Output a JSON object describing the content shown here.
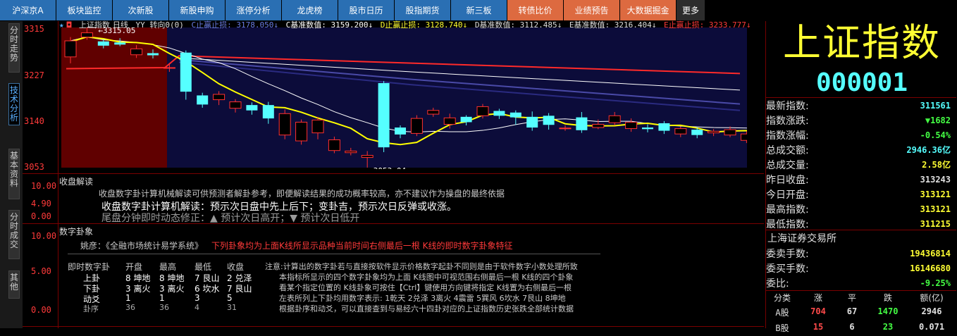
{
  "nav": [
    "沪深京A",
    "板块监控",
    "次新股",
    "新股申购",
    "涨停分析",
    "龙虎榜",
    "股市日历",
    "股指期货",
    "新三板",
    "转债比价",
    "业绩预告",
    "大数据掘金",
    "更多"
  ],
  "sidetabs": [
    "分时走势",
    "技术分析",
    "基本资料",
    "分时成交",
    "其他"
  ],
  "kchart": {
    "y_labels": [
      "3315",
      "3227",
      "3140",
      "3053"
    ],
    "legend": {
      "name": "上证指数",
      "period": "日线",
      "indicator": "YY 转向0(0)",
      "c_stop": "C止赢止损: 3178.050↓",
      "c_base": "C基准数值: 3159.200↓",
      "d_stop": "D止赢止损: 3128.740↓",
      "d_base": "D基准数值: 3112.485↓",
      "e_base": "E基准数值: 3216.404↓",
      "e_stop": "E止赢止损: 3233.777↓"
    },
    "high_label": "3315.05",
    "low_label": "3053.04"
  },
  "chart_data": {
    "type": "candlestick",
    "ylim": [
      3053,
      3315
    ],
    "high_annotation": 3315.05,
    "low_annotation": 3053.04,
    "candles": [
      [
        3260,
        3290,
        3297,
        3248
      ],
      [
        3297,
        3305,
        3315.05,
        3292
      ],
      [
        3289,
        3281,
        3293,
        3276
      ],
      [
        3287,
        3283,
        3295,
        3280
      ],
      [
        3264,
        3275,
        3282,
        3258
      ],
      [
        3267,
        3263,
        3274,
        3257
      ],
      [
        3240,
        3240,
        3247,
        3232
      ],
      [
        3268,
        3195,
        3272,
        3180
      ],
      [
        3188,
        3171,
        3193,
        3165
      ],
      [
        3180,
        3190,
        3196,
        3170
      ],
      [
        3164,
        3176,
        3181,
        3156
      ],
      [
        3170,
        3160,
        3175,
        3152
      ],
      [
        3170,
        3145,
        3176,
        3135
      ],
      [
        3114,
        3154,
        3162,
        3106
      ],
      [
        3103,
        3138,
        3143,
        3096
      ],
      [
        3118,
        3142,
        3148,
        3106
      ],
      [
        3085,
        3105,
        3111,
        3080
      ],
      [
        3081,
        3084,
        3090,
        3076
      ],
      [
        3072,
        3076,
        3084,
        3053.04
      ],
      [
        3211,
        3091,
        3215,
        3082
      ],
      [
        3128,
        3115,
        3132,
        3108
      ],
      [
        3117,
        3145,
        3151,
        3112
      ],
      [
        3153,
        3160,
        3165,
        3148
      ],
      [
        3134,
        3146,
        3154,
        3126
      ],
      [
        3148,
        3138,
        3151,
        3132
      ],
      [
        3150,
        3167,
        3172,
        3145
      ],
      [
        3159,
        3150,
        3163,
        3144
      ],
      [
        3156,
        3147,
        3160,
        3133
      ],
      [
        3148,
        3128,
        3158,
        3122
      ],
      [
        3150,
        3133,
        3155,
        3124
      ],
      [
        3127,
        3127,
        3132,
        3122
      ],
      [
        3147,
        3123,
        3157,
        3118
      ],
      [
        3128,
        3134,
        3143,
        3125
      ],
      [
        3137,
        3150,
        3157,
        3132
      ],
      [
        3126,
        3138,
        3145,
        3120
      ],
      [
        3128,
        3125,
        3134,
        3119
      ],
      [
        3136,
        3122,
        3140,
        3116
      ],
      [
        3116,
        3126,
        3130,
        3110
      ],
      [
        3124,
        3114,
        3128,
        3108
      ],
      [
        3118,
        3121,
        3125,
        3112
      ],
      [
        3114,
        3124,
        3130,
        3110
      ],
      [
        3104,
        3116,
        3121,
        3099
      ],
      [
        3110,
        3094,
        3114,
        3087
      ],
      [
        3090,
        3131,
        3134,
        3086
      ],
      [
        3133,
        3116,
        3136,
        3112
      ]
    ]
  },
  "shoupan": {
    "title": "收盘解读",
    "y_labels": [
      "10.00",
      "4.90",
      "0.00"
    ],
    "line1": "收盘数字卦计算机械解读可供预测者解卦参考，即便解读结果的成功概率较高，亦不建议作为操盘的最终依据",
    "line2": "收盘数字卦计算机解读：预示次日盘中先上后下；变卦吉，预示次日反弹或收涨。",
    "line3": "尾盘分钟即时动态修正：▲ 预计次日高开；▼ 预计次日低开"
  },
  "guaxiang": {
    "title": "数字卦象",
    "y_labels": [
      "10.00",
      "5.00",
      "0.00"
    ],
    "ref": "姚彦：《全融市场统计易学系统》",
    "ref_red": "下列卦象均为上面K线所显示品种当前时间右侧最后一根 K线的即时数字卦象特征",
    "headers": [
      "即时数字卦",
      "开盘",
      "最高",
      "最低",
      "收盘"
    ],
    "rows": [
      [
        "上卦",
        "8 坤地",
        "8 坤地",
        "7 艮山",
        "2 兑泽"
      ],
      [
        "下卦",
        "3 离火",
        "3 离火",
        "6 坎水",
        "7 艮山"
      ],
      [
        "动爻",
        "1",
        "1",
        "3",
        "5"
      ],
      [
        "卦序",
        "36",
        "36",
        "4",
        "31"
      ]
    ],
    "notes": [
      "注意:计算出的数字卦若与直接按软件显示价格数字起卦不同则是由于软件数字小数处理所致",
      "本指标所显示的四个数字卦象均为上面 K线图中可视范围右侧最后一根 K线的四个卦象",
      "看某个指定位置的 K线卦象可按住【Ctrl】键使用方向键将指定 K线置为右侧最后一根",
      "左表所列上下卦均用数字表示: 1乾天 2兑泽 3离火 4震雷 5巽风 6坎水 7艮山 8坤地",
      "根据卦序和动爻，可以直接查到与易经六十四卦对应的上证指数历史张跌全部统计数据"
    ]
  },
  "quote": {
    "name": "上证指数",
    "code": "000001",
    "rows": [
      {
        "label": "最新指数:",
        "value": "311561",
        "color": "#55ffff"
      },
      {
        "label": "指数涨跌:",
        "value": "▼1682",
        "color": "#44ff44"
      },
      {
        "label": "指数涨幅:",
        "value": "-0.54%",
        "color": "#44ff44"
      },
      {
        "label": "总成交额:",
        "value": "2946.36亿",
        "color": "#55ffff"
      },
      {
        "label": "总成交量:",
        "value": "2.58亿",
        "color": "#ffff33"
      },
      {
        "label": "昨日收盘:",
        "value": "313243",
        "color": "#e0e0e0"
      },
      {
        "label": "今日开盘:",
        "value": "313121",
        "color": "#ffff33"
      },
      {
        "label": "最高指数:",
        "value": "313121",
        "color": "#ffff33"
      },
      {
        "label": "最低指数:",
        "value": "311215",
        "color": "#ffff33"
      }
    ],
    "exchange": "上海证券交易所",
    "rows2": [
      {
        "label": "委卖手数:",
        "value": "19436814",
        "color": "#ffff33"
      },
      {
        "label": "委买手数:",
        "value": "16146680",
        "color": "#ffff33"
      },
      {
        "label": "委比:",
        "value": "-9.25%",
        "color": "#44ff44"
      }
    ],
    "stat_headers": [
      "分类",
      "涨",
      "平",
      "跌",
      "额(亿)"
    ],
    "stat_rows": [
      [
        "A股",
        "704",
        "67",
        "1470",
        "2946"
      ],
      [
        "B股",
        "15",
        "6",
        "23",
        "0.071"
      ]
    ]
  }
}
